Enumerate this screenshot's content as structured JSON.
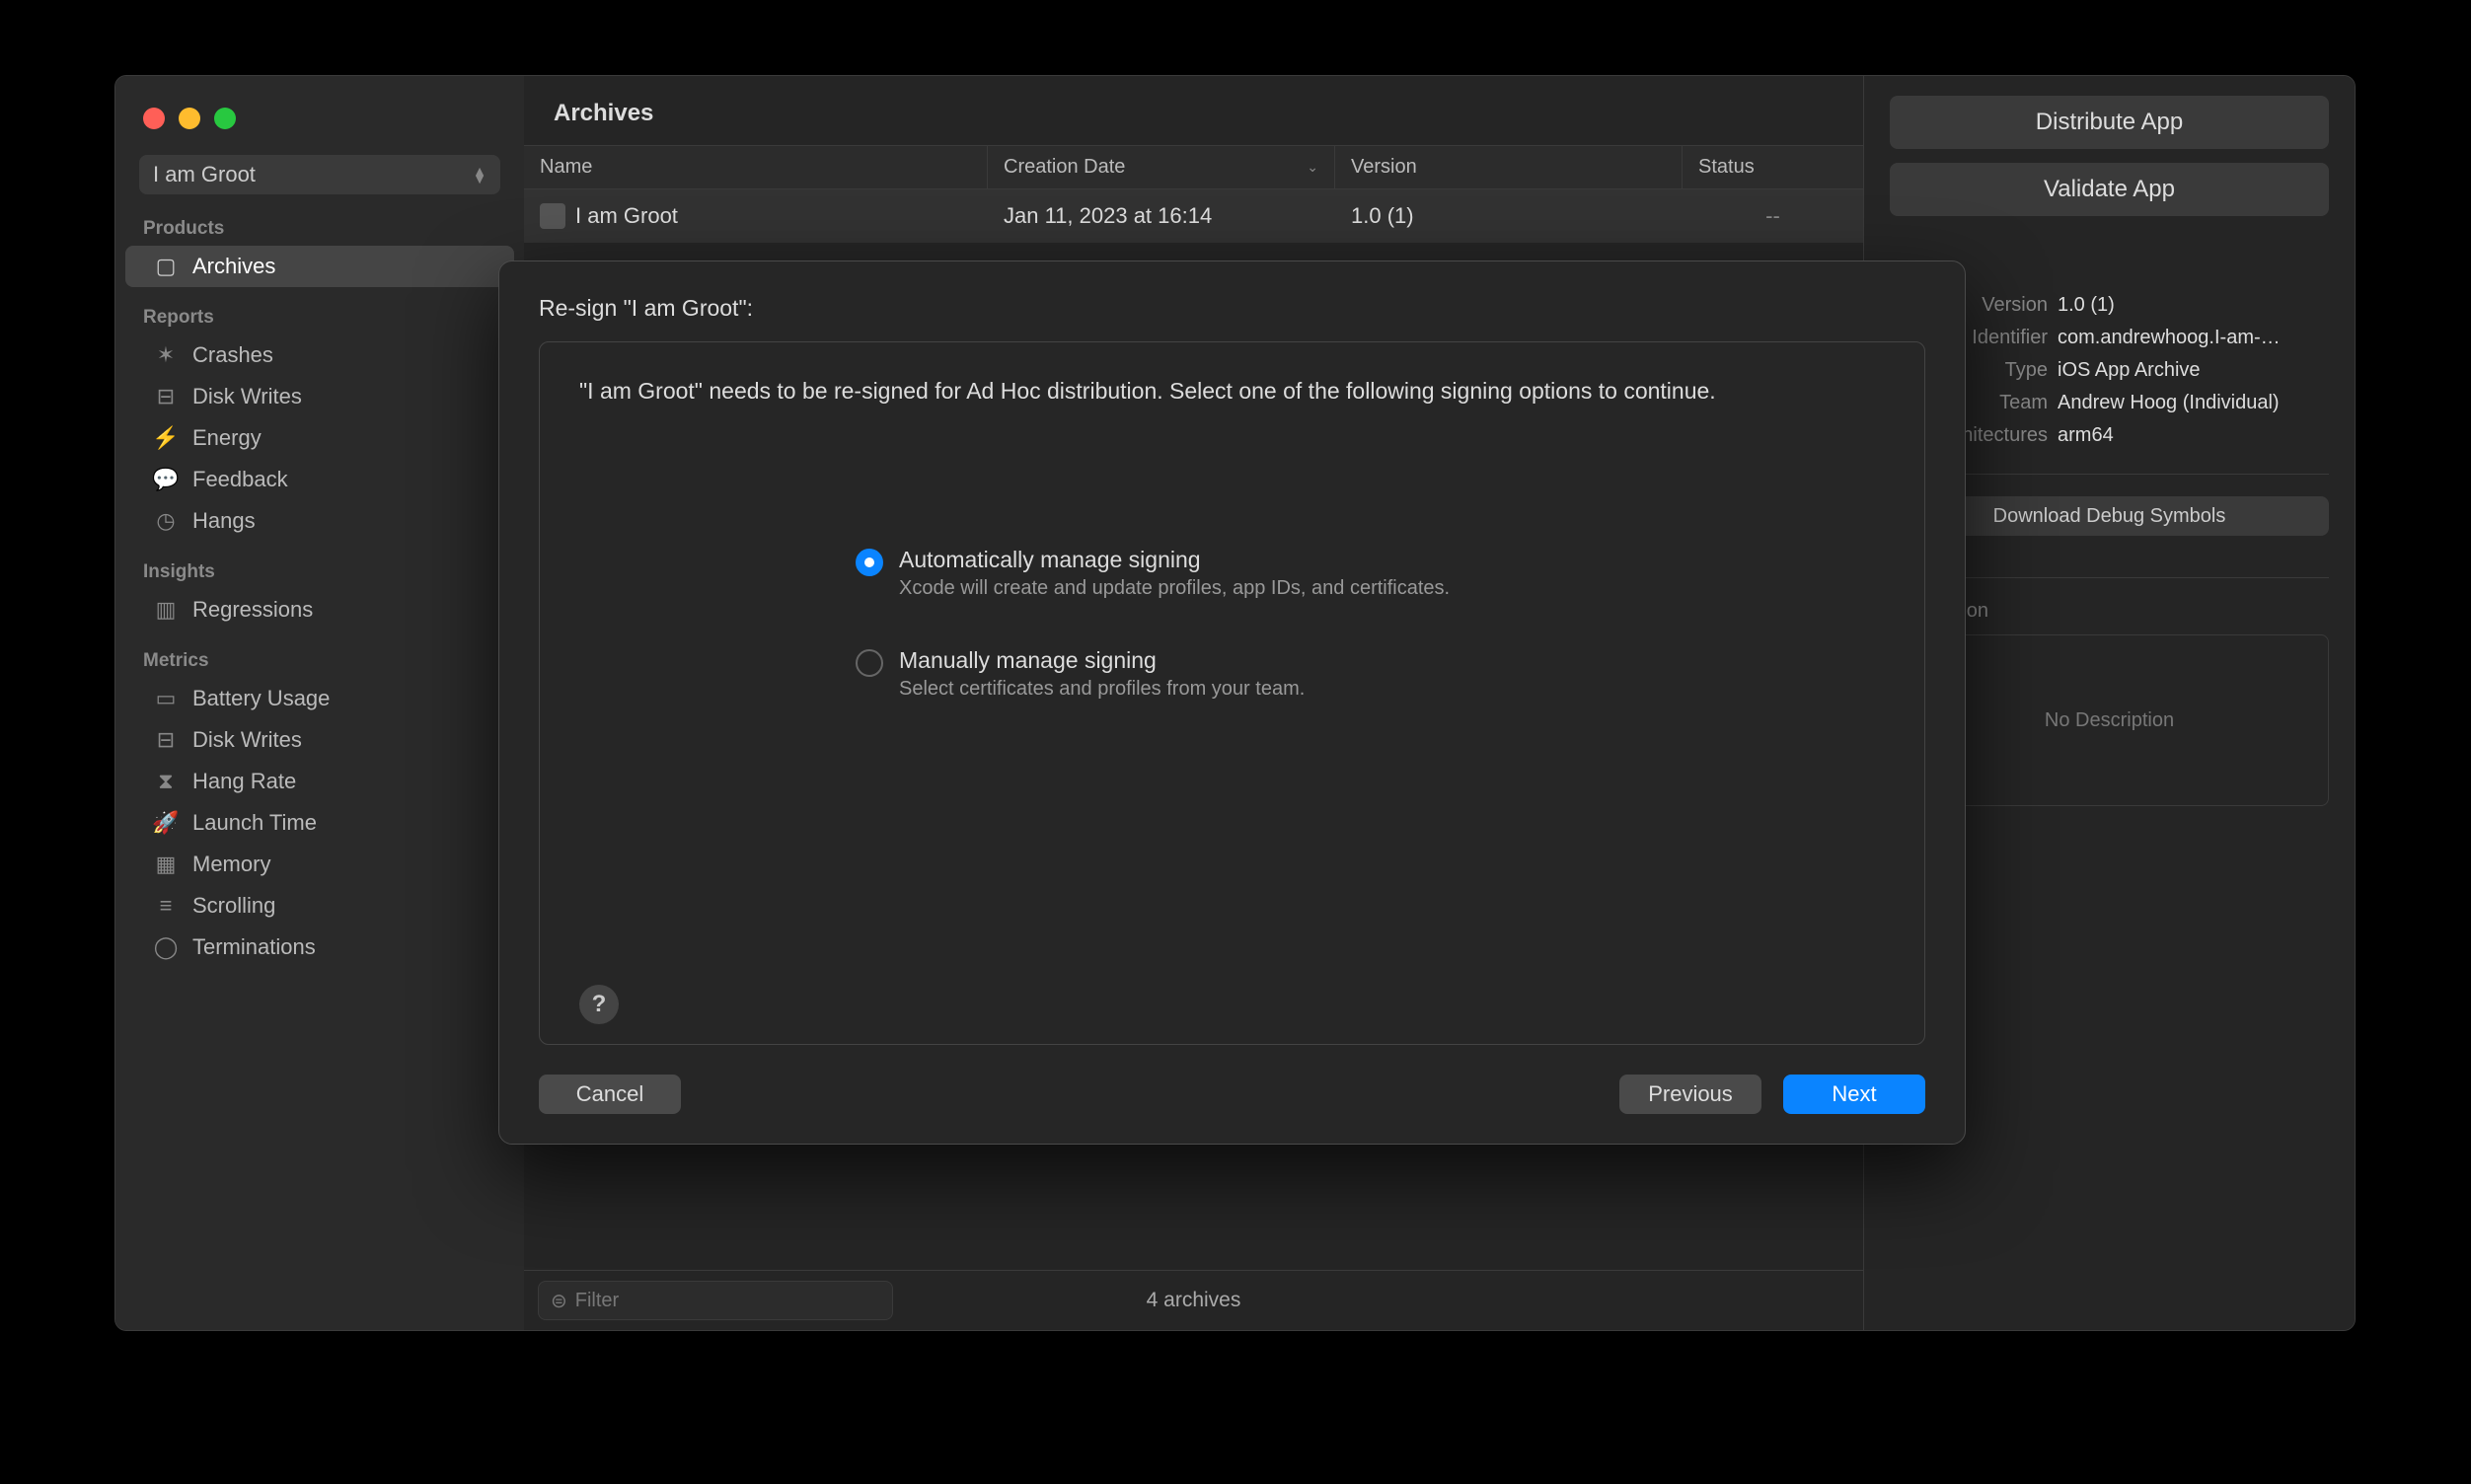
{
  "scheme": "I am Groot",
  "sidebar": {
    "sections": {
      "products": {
        "header": "Products",
        "items": [
          "Archives"
        ]
      },
      "reports": {
        "header": "Reports",
        "items": [
          "Crashes",
          "Disk Writes",
          "Energy",
          "Feedback",
          "Hangs"
        ]
      },
      "insights": {
        "header": "Insights",
        "items": [
          "Regressions"
        ]
      },
      "metrics": {
        "header": "Metrics",
        "items": [
          "Battery Usage",
          "Disk Writes",
          "Hang Rate",
          "Launch Time",
          "Memory",
          "Scrolling",
          "Terminations"
        ]
      }
    }
  },
  "main": {
    "title": "Archives",
    "columns": {
      "name": "Name",
      "date": "Creation Date",
      "version": "Version",
      "status": "Status"
    },
    "row": {
      "name": "I am Groot",
      "date": "Jan 11, 2023 at 16:14",
      "version": "1.0 (1)",
      "status": "--"
    },
    "filter_placeholder": "Filter",
    "count": "4 archives"
  },
  "right": {
    "distribute": "Distribute App",
    "validate": "Validate App",
    "meta": {
      "version_k": "Version",
      "version_v": "1.0 (1)",
      "identifier_k": "Identifier",
      "identifier_v": "com.andrewhoog.I-am-…",
      "type_k": "Type",
      "type_v": "iOS App Archive",
      "team_k": "Team",
      "team_v": "Andrew Hoog (Individual)",
      "arch_k": "Architectures",
      "arch_v": "arm64"
    },
    "download": "Download Debug Symbols",
    "desc_header": "Description",
    "desc_placeholder": "No Description"
  },
  "modal": {
    "title": "Re-sign \"I am Groot\":",
    "message": "\"I am Groot\" needs to be re-signed for Ad Hoc distribution. Select one of the following signing options to continue.",
    "opt1": {
      "label": "Automatically manage signing",
      "sub": "Xcode will create and update profiles, app IDs, and certificates."
    },
    "opt2": {
      "label": "Manually manage signing",
      "sub": "Select certificates and profiles from your team."
    },
    "help": "?",
    "cancel": "Cancel",
    "previous": "Previous",
    "next": "Next"
  }
}
